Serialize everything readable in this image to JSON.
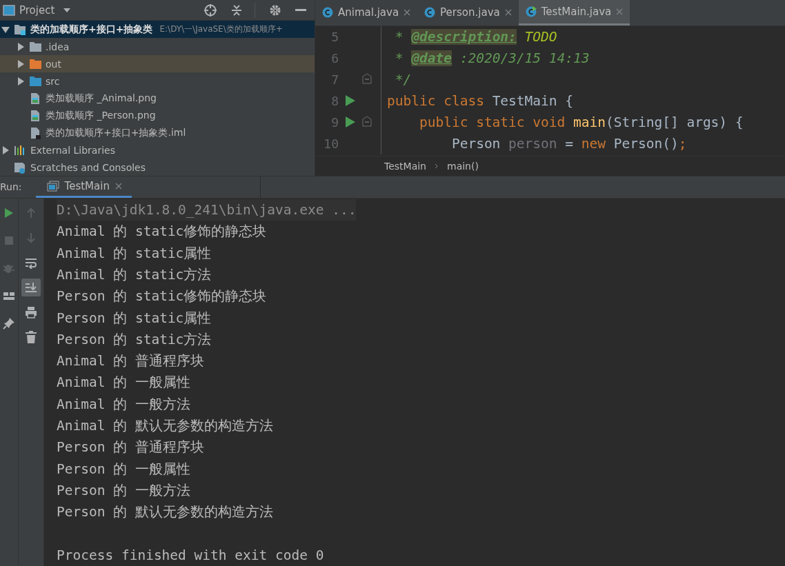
{
  "project_panel": {
    "title": "Project",
    "toolbar": [
      {
        "kind": "locate"
      },
      {
        "kind": "collapse"
      },
      {
        "kind": "settings"
      },
      {
        "kind": "hide"
      }
    ],
    "tree": [
      {
        "label": "类的加载顺序+接口+抽象类",
        "path": "E:\\DY\\一\\JavaSE\\类的加载顺序+",
        "kind": "module",
        "expanded": true,
        "selected": true,
        "hovered": false,
        "children": [
          {
            "label": ".idea",
            "kind": "folder",
            "expanded": false,
            "selected": false,
            "hovered": false
          },
          {
            "label": "out",
            "kind": "excluded-folder",
            "expanded": false,
            "selected": false,
            "hovered": true
          },
          {
            "label": "src",
            "kind": "source-folder",
            "expanded": false,
            "selected": false,
            "hovered": false
          },
          {
            "label": "类加载顺序 _Animal.png",
            "kind": "image-file",
            "selected": false,
            "hovered": false
          },
          {
            "label": "类加载顺序 _Person.png",
            "kind": "image-file",
            "selected": false,
            "hovered": false
          },
          {
            "label": "类的加载顺序+接口+抽象类.iml",
            "kind": "module-file",
            "selected": false,
            "hovered": false
          }
        ]
      },
      {
        "label": "External Libraries",
        "kind": "libraries",
        "expanded": false,
        "selected": false,
        "hovered": false
      },
      {
        "label": "Scratches and Consoles",
        "kind": "scratches",
        "selected": false,
        "hovered": false
      }
    ]
  },
  "editor": {
    "tabs": [
      {
        "label": "Animal.java",
        "selected": false,
        "runnable": false
      },
      {
        "label": "Person.java",
        "selected": false,
        "runnable": false
      },
      {
        "label": "TestMain.java",
        "selected": true,
        "runnable": true
      }
    ],
    "lines": [
      {
        "number": "5",
        "run_marker": false,
        "fold_marker": false,
        "tokens": [
          {
            "kind": "comment",
            "text": " * "
          },
          {
            "kind": "doc-tag",
            "text": "@description:"
          },
          {
            "kind": "todo",
            "text": " TODO"
          }
        ]
      },
      {
        "number": "6",
        "run_marker": false,
        "fold_marker": false,
        "tokens": [
          {
            "kind": "comment",
            "text": " * "
          },
          {
            "kind": "doc-tag",
            "text": "@date"
          },
          {
            "kind": "comment",
            "text": " :2020/3/15 14:13"
          }
        ]
      },
      {
        "number": "7",
        "run_marker": false,
        "fold_marker": true,
        "tokens": [
          {
            "kind": "comment",
            "text": " */"
          }
        ]
      },
      {
        "number": "8",
        "run_marker": true,
        "fold_marker": false,
        "tokens": [
          {
            "kind": "keyword",
            "text": "public class "
          },
          {
            "kind": "plain",
            "text": "TestMain {"
          }
        ]
      },
      {
        "number": "9",
        "run_marker": true,
        "fold_marker": true,
        "tokens": [
          {
            "kind": "keyword",
            "text": "    public static void "
          },
          {
            "kind": "method",
            "text": "main"
          },
          {
            "kind": "plain",
            "text": "(String[] args) {"
          }
        ]
      },
      {
        "number": "10",
        "run_marker": false,
        "fold_marker": false,
        "tokens": [
          {
            "kind": "plain",
            "text": "        Person "
          },
          {
            "kind": "unused",
            "text": "person"
          },
          {
            "kind": "plain",
            "text": " = "
          },
          {
            "kind": "keyword",
            "text": "new "
          },
          {
            "kind": "plain",
            "text": "Person()"
          },
          {
            "kind": "keyword",
            "text": ";"
          }
        ]
      }
    ],
    "breadcrumbs": [
      "TestMain",
      "main()"
    ]
  },
  "run_panel": {
    "label": "Run:",
    "tabs": [
      {
        "label": "TestMain",
        "selected": true
      }
    ],
    "toolbar_left": [
      {
        "kind": "rerun",
        "disabled": false
      },
      {
        "kind": "stop",
        "disabled": true
      },
      {
        "kind": "debug",
        "disabled": true
      },
      {
        "kind": "layout",
        "disabled": false
      },
      {
        "kind": "pin",
        "disabled": false
      }
    ],
    "toolbar_right": [
      {
        "kind": "up",
        "disabled": true,
        "selected": false
      },
      {
        "kind": "down",
        "disabled": true,
        "selected": false
      },
      {
        "kind": "wrap",
        "disabled": false,
        "selected": false
      },
      {
        "kind": "scroll-end",
        "disabled": false,
        "selected": true
      },
      {
        "kind": "print",
        "disabled": false,
        "selected": false
      },
      {
        "kind": "trash",
        "disabled": false,
        "selected": false
      }
    ],
    "console": [
      {
        "kind": "command",
        "text": "D:\\Java\\jdk1.8.0_241\\bin\\java.exe ..."
      },
      {
        "kind": "output",
        "text": "Animal 的 static修饰的静态块"
      },
      {
        "kind": "output",
        "text": "Animal 的 static属性"
      },
      {
        "kind": "output",
        "text": "Animal 的 static方法"
      },
      {
        "kind": "output",
        "text": "Person 的 static修饰的静态块"
      },
      {
        "kind": "output",
        "text": "Person 的 static属性"
      },
      {
        "kind": "output",
        "text": "Person 的 static方法"
      },
      {
        "kind": "output",
        "text": "Animal 的 普通程序块"
      },
      {
        "kind": "output",
        "text": "Animal 的 一般属性"
      },
      {
        "kind": "output",
        "text": "Animal 的 一般方法"
      },
      {
        "kind": "output",
        "text": "Animal 的 默认无参数的构造方法"
      },
      {
        "kind": "output",
        "text": "Person 的 普通程序块"
      },
      {
        "kind": "output",
        "text": "Person 的 一般属性"
      },
      {
        "kind": "output",
        "text": "Person 的 一般方法"
      },
      {
        "kind": "output",
        "text": "Person 的 默认无参数的构造方法"
      },
      {
        "kind": "blank"
      },
      {
        "kind": "output",
        "text": "Process finished with exit code 0"
      }
    ]
  }
}
